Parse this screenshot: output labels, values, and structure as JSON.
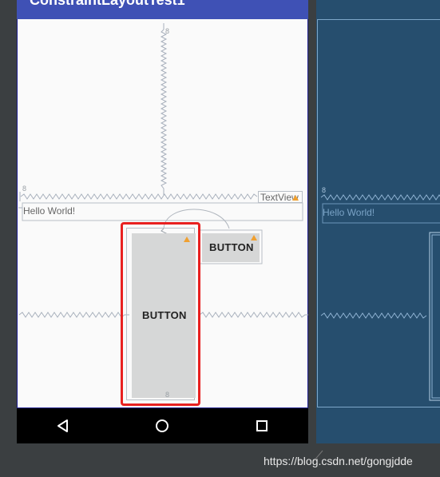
{
  "app": {
    "title": "ConstraintLayoutTest1"
  },
  "design": {
    "textview_tag": "TextView",
    "hello_text": "Hello World!",
    "button_small": "BUTTON",
    "button_tall": "BUTTON",
    "margin_top": "8",
    "margin_left": "8",
    "margin_bottom": "8"
  },
  "blueprint": {
    "hello_text": "Hello World!",
    "margin_left": "8"
  },
  "watermark": "https://blog.csdn.net/gongjdde",
  "colors": {
    "app_bar": "#3f51b5",
    "blueprint_bg": "#264e6e",
    "selection": "#e82020",
    "warning": "#f0a030"
  }
}
